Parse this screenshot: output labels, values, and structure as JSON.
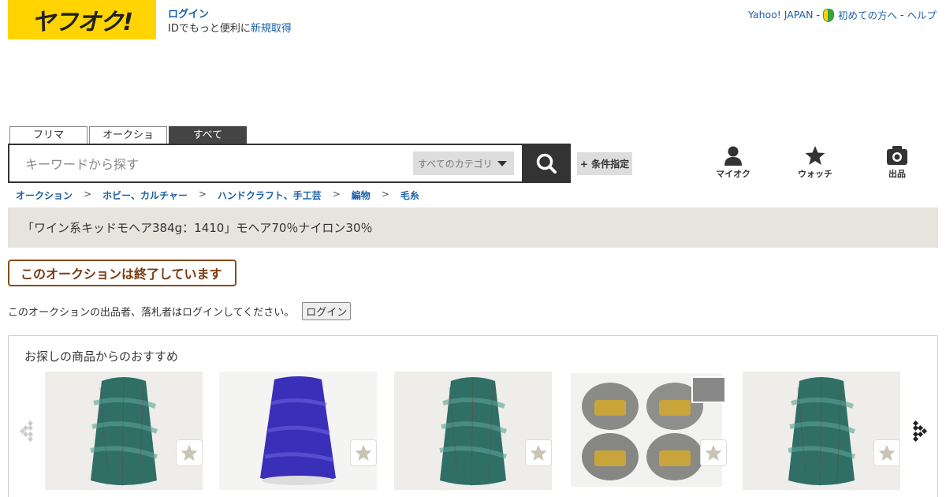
{
  "header": {
    "logo_text": "ヤフオク!",
    "login_link": "ログイン",
    "login_sub": "IDでもっと便利に",
    "signup_link": "新規取得",
    "top_links": {
      "yahoo": "Yahoo! JAPAN",
      "sep1": "-",
      "beginner": "初めての方へ",
      "sep2": "-",
      "help": "ヘルプ"
    }
  },
  "search": {
    "tabs": [
      "フリマ",
      "オークション",
      "すべて"
    ],
    "active_tab": "すべて",
    "placeholder": "キーワードから探す",
    "category": "すべてのカテゴリ",
    "condition_button": "+ 条件指定"
  },
  "nav": {
    "my_auction": "マイオク",
    "watch": "ウォッチ",
    "sell": "出品"
  },
  "breadcrumb": [
    "オークション",
    "ホビー、カルチャー",
    "ハンドクラフト、手工芸",
    "編物",
    "毛糸"
  ],
  "breadcrumb_sep": ">",
  "item": {
    "title": "「ワイン系キッドモヘア384g：1410」モヘア70％ナイロン30％",
    "ended_text": "このオークションは終了しています",
    "login_message": "このオークションの出品者、落札者はログインしてください。",
    "login_button": "ログイン"
  },
  "recommendations": {
    "title": "お探しの商品からのおすすめ",
    "items": [
      {
        "color": "#2f6f66",
        "kind": "cone"
      },
      {
        "color": "#3a2fb8",
        "kind": "cone"
      },
      {
        "color": "#2f6f66",
        "kind": "cone"
      },
      {
        "color": "#8a8a8a",
        "kind": "balls"
      },
      {
        "color": "#2f6f66",
        "kind": "cone"
      }
    ]
  },
  "colors": {
    "brand_yellow": "#ffd400",
    "link_blue": "#1a5fa8",
    "title_bg": "#e6e4dd",
    "ended_brown": "#8a4a1a"
  }
}
